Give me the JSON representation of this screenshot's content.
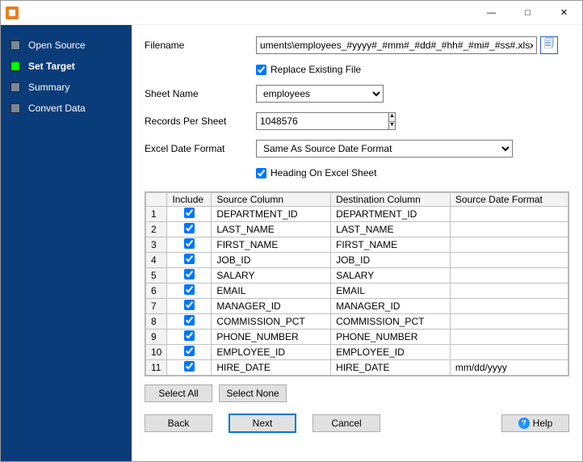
{
  "window": {
    "title": ""
  },
  "sidebar": {
    "items": [
      {
        "label": "Open Source",
        "active": false
      },
      {
        "label": "Set Target",
        "active": true
      },
      {
        "label": "Summary",
        "active": false
      },
      {
        "label": "Convert Data",
        "active": false
      }
    ]
  },
  "form": {
    "filename_label": "Filename",
    "filename_value": "uments\\employees_#yyyy#_#mm#_#dd#_#hh#_#mi#_#ss#.xlsx",
    "replace_label": "Replace Existing File",
    "replace_checked": true,
    "sheet_label": "Sheet Name",
    "sheet_value": "employees",
    "records_label": "Records Per Sheet",
    "records_value": "1048576",
    "dateformat_label": "Excel Date Format",
    "dateformat_value": "Same As Source Date Format",
    "heading_label": "Heading On Excel Sheet",
    "heading_checked": true
  },
  "grid": {
    "headers": {
      "include": "Include",
      "source": "Source Column",
      "dest": "Destination Column",
      "datefmt": "Source Date Format"
    },
    "rows": [
      {
        "n": "1",
        "inc": true,
        "src": "DEPARTMENT_ID",
        "dst": "DEPARTMENT_ID",
        "fmt": ""
      },
      {
        "n": "2",
        "inc": true,
        "src": "LAST_NAME",
        "dst": "LAST_NAME",
        "fmt": ""
      },
      {
        "n": "3",
        "inc": true,
        "src": "FIRST_NAME",
        "dst": "FIRST_NAME",
        "fmt": ""
      },
      {
        "n": "4",
        "inc": true,
        "src": "JOB_ID",
        "dst": "JOB_ID",
        "fmt": ""
      },
      {
        "n": "5",
        "inc": true,
        "src": "SALARY",
        "dst": "SALARY",
        "fmt": ""
      },
      {
        "n": "6",
        "inc": true,
        "src": "EMAIL",
        "dst": "EMAIL",
        "fmt": ""
      },
      {
        "n": "7",
        "inc": true,
        "src": "MANAGER_ID",
        "dst": "MANAGER_ID",
        "fmt": ""
      },
      {
        "n": "8",
        "inc": true,
        "src": "COMMISSION_PCT",
        "dst": "COMMISSION_PCT",
        "fmt": ""
      },
      {
        "n": "9",
        "inc": true,
        "src": "PHONE_NUMBER",
        "dst": "PHONE_NUMBER",
        "fmt": ""
      },
      {
        "n": "10",
        "inc": true,
        "src": "EMPLOYEE_ID",
        "dst": "EMPLOYEE_ID",
        "fmt": ""
      },
      {
        "n": "11",
        "inc": true,
        "src": "HIRE_DATE",
        "dst": "HIRE_DATE",
        "fmt": "mm/dd/yyyy"
      }
    ]
  },
  "buttons": {
    "select_all": "Select All",
    "select_none": "Select None",
    "back": "Back",
    "next": "Next",
    "cancel": "Cancel",
    "help": "Help"
  }
}
